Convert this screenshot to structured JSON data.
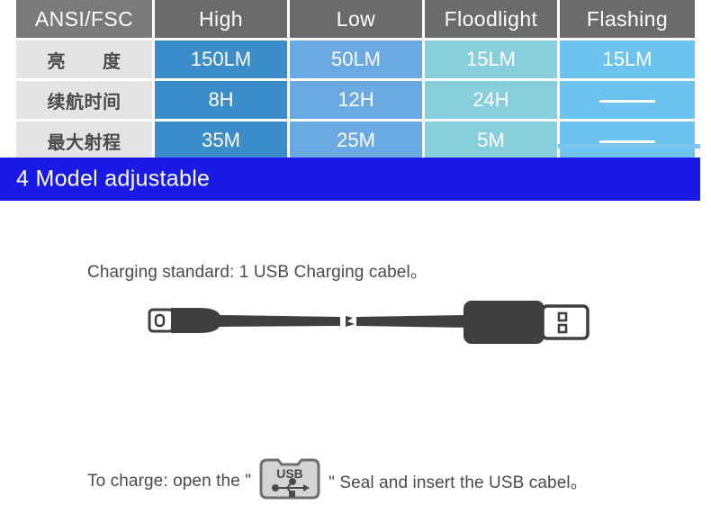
{
  "table": {
    "headers": [
      "ANSI/FSC",
      "High",
      "Low",
      "Floodlight",
      "Flashing"
    ],
    "rows": [
      {
        "label": "亮　　度",
        "values": [
          "150LM",
          "50LM",
          "15LM",
          "15LM"
        ]
      },
      {
        "label": "续航时间",
        "values": [
          "8H",
          "12H",
          "24H",
          "—"
        ]
      },
      {
        "label": "最大射程",
        "values": [
          "35M",
          "25M",
          "5M",
          "—"
        ]
      }
    ],
    "colors": {
      "header_bg": "#6b6b6b",
      "label_bg": "#e4e4e4",
      "high": "#3a8dc8",
      "low": "#6aa9e3",
      "floodlight": "#88cfdd",
      "flashing": "#6cc3f0"
    }
  },
  "banner": {
    "title": "4 Model adjustable",
    "bg_color": "#1a1ae6",
    "strip_color": "#7ec4ee"
  },
  "charging": {
    "standard_text": "Charging standard: 1 USB Charging cabel。",
    "cable_color": "#3f3f3f"
  },
  "instruction": {
    "before_icon": "To charge: open the \"",
    "icon_label": "USB",
    "after_icon": "\" Seal and insert the USB cabel。"
  }
}
